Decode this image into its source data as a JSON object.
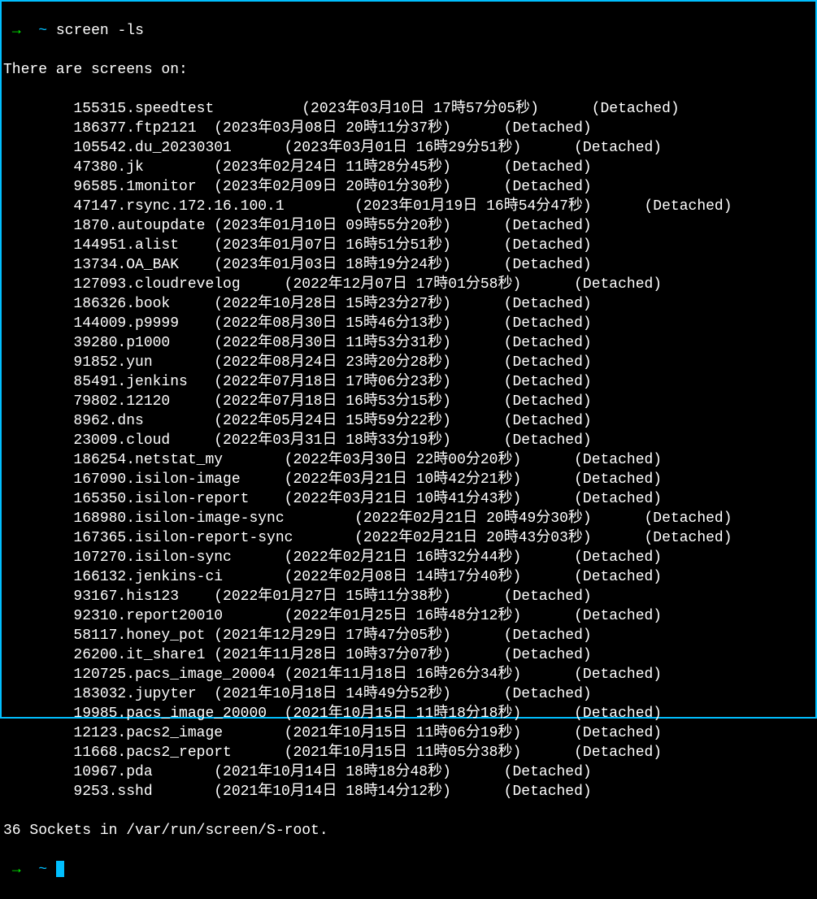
{
  "prompt": {
    "arrow": "→",
    "tilde": "~",
    "command": "screen -ls"
  },
  "header": "There are screens on:",
  "sessions": [
    {
      "name": "155315.speedtest",
      "date": "(2023年03月10日 17時57分05秒)",
      "status": "(Detached)",
      "pad1": 10,
      "pad2": 6
    },
    {
      "name": "186377.ftp2121",
      "date": "(2023年03月08日 20時11分37秒)",
      "status": "(Detached)",
      "pad1": 2,
      "pad2": 6
    },
    {
      "name": "105542.du_20230301",
      "date": "(2023年03月01日 16時29分51秒)",
      "status": "(Detached)",
      "pad1": 6,
      "pad2": 6
    },
    {
      "name": "47380.jk",
      "date": "(2023年02月24日 11時28分45秒)",
      "status": "(Detached)",
      "pad1": 8,
      "pad2": 6
    },
    {
      "name": "96585.1monitor",
      "date": "(2023年02月09日 20時01分30秒)",
      "status": "(Detached)",
      "pad1": 2,
      "pad2": 6
    },
    {
      "name": "47147.rsync.172.16.100.1",
      "date": "(2023年01月19日 16時54分47秒)",
      "status": "(Detached)",
      "pad1": 8,
      "pad2": 6
    },
    {
      "name": "1870.autoupdate",
      "date": "(2023年01月10日 09時55分20秒)",
      "status": "(Detached)",
      "pad1": 1,
      "pad2": 6
    },
    {
      "name": "144951.alist",
      "date": "(2023年01月07日 16時51分51秒)",
      "status": "(Detached)",
      "pad1": 4,
      "pad2": 6
    },
    {
      "name": "13734.OA_BAK",
      "date": "(2023年01月03日 18時19分24秒)",
      "status": "(Detached)",
      "pad1": 4,
      "pad2": 6
    },
    {
      "name": "127093.cloudrevelog",
      "date": "(2022年12月07日 17時01分58秒)",
      "status": "(Detached)",
      "pad1": 5,
      "pad2": 6
    },
    {
      "name": "186326.book",
      "date": "(2022年10月28日 15時23分27秒)",
      "status": "(Detached)",
      "pad1": 5,
      "pad2": 6
    },
    {
      "name": "144009.p9999",
      "date": "(2022年08月30日 15時46分13秒)",
      "status": "(Detached)",
      "pad1": 4,
      "pad2": 6
    },
    {
      "name": "39280.p1000",
      "date": "(2022年08月30日 11時53分31秒)",
      "status": "(Detached)",
      "pad1": 5,
      "pad2": 6
    },
    {
      "name": "91852.yun",
      "date": "(2022年08月24日 23時20分28秒)",
      "status": "(Detached)",
      "pad1": 7,
      "pad2": 6
    },
    {
      "name": "85491.jenkins",
      "date": "(2022年07月18日 17時06分23秒)",
      "status": "(Detached)",
      "pad1": 3,
      "pad2": 6
    },
    {
      "name": "79802.12120",
      "date": "(2022年07月18日 16時53分15秒)",
      "status": "(Detached)",
      "pad1": 5,
      "pad2": 6
    },
    {
      "name": "8962.dns",
      "date": "(2022年05月24日 15時59分22秒)",
      "status": "(Detached)",
      "pad1": 8,
      "pad2": 6
    },
    {
      "name": "23009.cloud",
      "date": "(2022年03月31日 18時33分19秒)",
      "status": "(Detached)",
      "pad1": 5,
      "pad2": 6
    },
    {
      "name": "186254.netstat_my",
      "date": "(2022年03月30日 22時00分20秒)",
      "status": "(Detached)",
      "pad1": 7,
      "pad2": 6
    },
    {
      "name": "167090.isilon-image",
      "date": "(2022年03月21日 10時42分21秒)",
      "status": "(Detached)",
      "pad1": 5,
      "pad2": 6
    },
    {
      "name": "165350.isilon-report",
      "date": "(2022年03月21日 10時41分43秒)",
      "status": "(Detached)",
      "pad1": 4,
      "pad2": 6
    },
    {
      "name": "168980.isilon-image-sync",
      "date": "(2022年02月21日 20時49分30秒)",
      "status": "(Detached)",
      "pad1": 8,
      "pad2": 6
    },
    {
      "name": "167365.isilon-report-sync",
      "date": "(2022年02月21日 20時43分03秒)",
      "status": "(Detached)",
      "pad1": 7,
      "pad2": 6
    },
    {
      "name": "107270.isilon-sync",
      "date": "(2022年02月21日 16時32分44秒)",
      "status": "(Detached)",
      "pad1": 6,
      "pad2": 6
    },
    {
      "name": "166132.jenkins-ci",
      "date": "(2022年02月08日 14時17分40秒)",
      "status": "(Detached)",
      "pad1": 7,
      "pad2": 6
    },
    {
      "name": "93167.his123",
      "date": "(2022年01月27日 15時11分38秒)",
      "status": "(Detached)",
      "pad1": 4,
      "pad2": 6
    },
    {
      "name": "92310.report20010",
      "date": "(2022年01月25日 16時48分12秒)",
      "status": "(Detached)",
      "pad1": 7,
      "pad2": 6
    },
    {
      "name": "58117.honey_pot",
      "date": "(2021年12月29日 17時47分05秒)",
      "status": "(Detached)",
      "pad1": 1,
      "pad2": 6
    },
    {
      "name": "26200.it_share1",
      "date": "(2021年11月28日 10時37分07秒)",
      "status": "(Detached)",
      "pad1": 1,
      "pad2": 6
    },
    {
      "name": "120725.pacs_image_20004",
      "date": "(2021年11月18日 16時26分34秒)",
      "status": "(Detached)",
      "pad1": 1,
      "pad2": 6
    },
    {
      "name": "183032.jupyter",
      "date": "(2021年10月18日 14時49分52秒)",
      "status": "(Detached)",
      "pad1": 2,
      "pad2": 6
    },
    {
      "name": "19985.pacs_image_20000",
      "date": "(2021年10月15日 11時18分18秒)",
      "status": "(Detached)",
      "pad1": 2,
      "pad2": 6
    },
    {
      "name": "12123.pacs2_image",
      "date": "(2021年10月15日 11時06分19秒)",
      "status": "(Detached)",
      "pad1": 7,
      "pad2": 6
    },
    {
      "name": "11668.pacs2_report",
      "date": "(2021年10月15日 11時05分38秒)",
      "status": "(Detached)",
      "pad1": 6,
      "pad2": 6
    },
    {
      "name": "10967.pda",
      "date": "(2021年10月14日 18時18分48秒)",
      "status": "(Detached)",
      "pad1": 7,
      "pad2": 6
    },
    {
      "name": "9253.sshd",
      "date": "(2021年10月14日 18時14分12秒)",
      "status": "(Detached)",
      "pad1": 7,
      "pad2": 6
    }
  ],
  "footer": "36 Sockets in /var/run/screen/S-root.",
  "final_prompt": {
    "arrow": "→",
    "tilde": "~"
  }
}
